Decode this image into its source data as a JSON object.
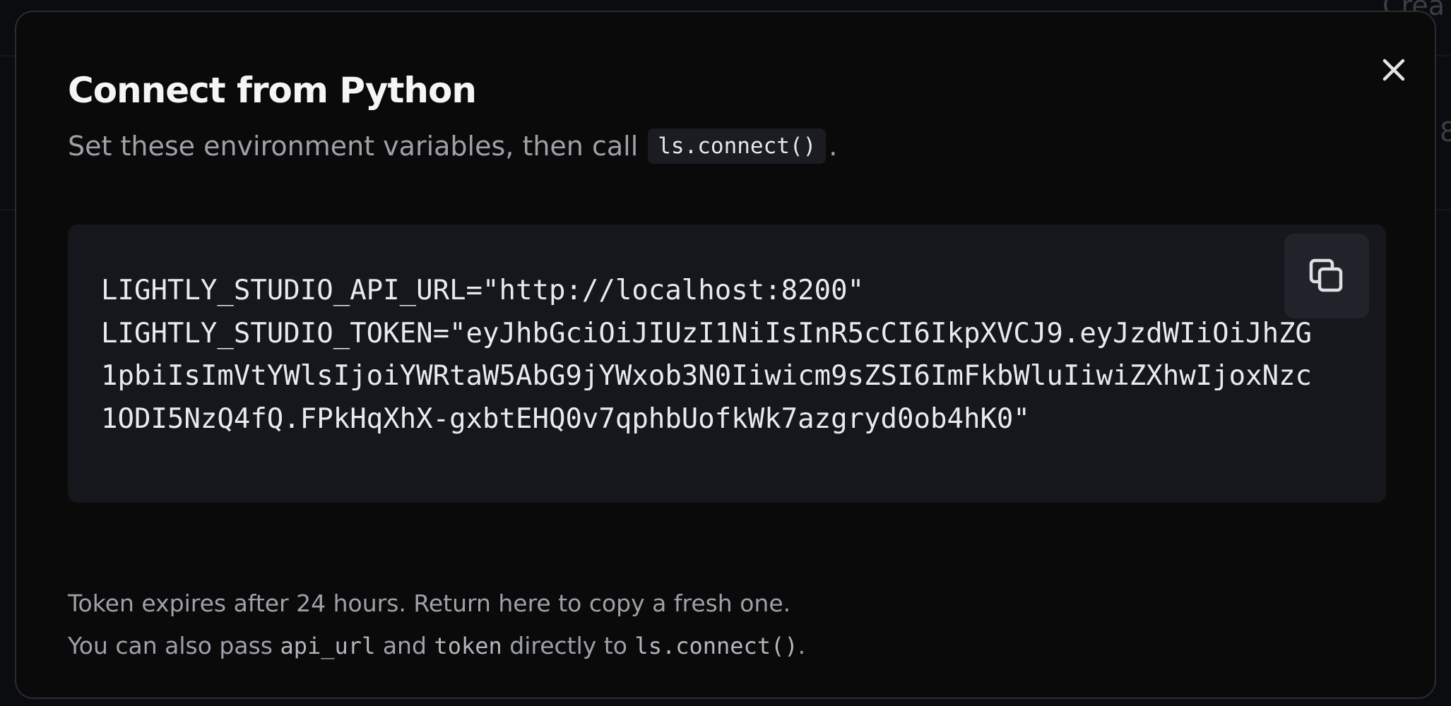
{
  "background": {
    "peek_text_top": "Crea",
    "peek_text_right": "8"
  },
  "modal": {
    "title": "Connect from Python",
    "subtitle": {
      "text": "Set these environment variables, then call",
      "code": "ls.connect()",
      "suffix": "."
    },
    "code_block": {
      "content": "LIGHTLY_STUDIO_API_URL=\"http://localhost:8200\"\nLIGHTLY_STUDIO_TOKEN=\"eyJhbGciOiJIUzI1NiIsInR5cCI6IkpXVCJ9.eyJzdWIiOiJhZG1pbiIsImVtYWlsIjoiYWRtaW5AbG9jYWxob3N0Iiwicm9sZSI6ImFkbWluIiwiZXhwIjoxNzc1ODI5NzQ4fQ.FPkHqXhX-gxbtEHQ0v7qphbUofkWk7azgryd0ob4hK0\""
    },
    "footer": {
      "line1": "Token expires after 24 hours. Return here to copy a fresh one.",
      "line2": {
        "prefix": "You can also pass",
        "code1": "api_url",
        "middle": "and",
        "code2": "token",
        "between": "directly to",
        "code3": "ls.connect()",
        "suffix": "."
      }
    },
    "icons": {
      "close": "close-icon",
      "copy": "copy-icon"
    }
  },
  "colors": {
    "modal_bg": "#0a0a0a",
    "code_bg": "#15171c",
    "copy_button_bg": "#20232a",
    "text_primary": "#f4f5f7",
    "text_secondary": "#9ea1a8"
  }
}
